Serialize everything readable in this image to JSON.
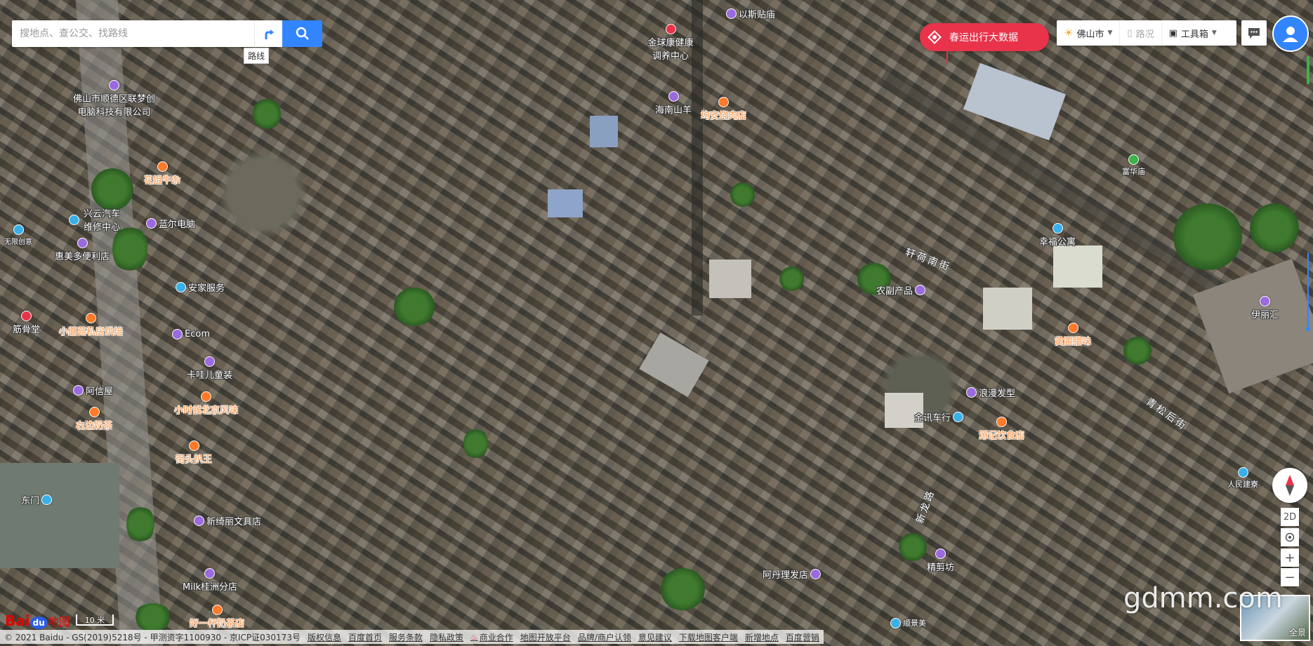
{
  "search": {
    "placeholder": "搜地点、查公交、找路线",
    "route_tooltip": "路线"
  },
  "banner": {
    "label": "春运出行大数据"
  },
  "toolbar": {
    "city": "佛山市",
    "traffic": "路况",
    "tools": "工具箱"
  },
  "controls": {
    "mode_2d": "2D",
    "zoom_in": "+",
    "zoom_out": "−",
    "panorama": "全景"
  },
  "scale": {
    "label": "10 米"
  },
  "logo": {
    "bai": "Bai",
    "du": "du",
    "map": "地图"
  },
  "watermark": "gdmm.com",
  "colors": {
    "accent": "#3385ff",
    "poi_shop": "#9c6adf",
    "poi_food": "#ff7a29",
    "poi_service": "#3ab0e8",
    "poi_health": "#e8334a",
    "poi_park": "#3db24a"
  },
  "pois": [
    {
      "name": "以斯贴庙",
      "cat": "shop"
    },
    {
      "name": "金球康健康调养中心",
      "cat": "health"
    },
    {
      "name": "佛山市顺德区联梦创电脑科技有限公司",
      "cat": "shop"
    },
    {
      "name": "海南山羊",
      "cat": "shop"
    },
    {
      "name": "均安烧肉店",
      "cat": "food"
    },
    {
      "name": "花姐牛杂",
      "cat": "food"
    },
    {
      "name": "兴云汽车维修中心",
      "cat": "service"
    },
    {
      "name": "蓝尔电脑",
      "cat": "shop"
    },
    {
      "name": "无限创意",
      "cat": "service"
    },
    {
      "name": "惠美多便利店",
      "cat": "shop"
    },
    {
      "name": "安家服务",
      "cat": "service"
    },
    {
      "name": "筋骨堂",
      "cat": "health"
    },
    {
      "name": "小蘑菇私房烘焙",
      "cat": "food"
    },
    {
      "name": "Ecom",
      "cat": "shop"
    },
    {
      "name": "卡哇儿童装",
      "cat": "shop"
    },
    {
      "name": "阿信屋",
      "cat": "shop"
    },
    {
      "name": "小时候北京风味",
      "cat": "food"
    },
    {
      "name": "右边奶茶",
      "cat": "food"
    },
    {
      "name": "街头扒王",
      "cat": "food"
    },
    {
      "name": "东门",
      "cat": "service"
    },
    {
      "name": "新绮丽文具店",
      "cat": "shop"
    },
    {
      "name": "Milk桂洲分店",
      "cat": "shop"
    },
    {
      "name": "好一杯奶茶店",
      "cat": "food"
    },
    {
      "name": "农副产品",
      "cat": "shop"
    },
    {
      "name": "幸福公寓",
      "cat": "service"
    },
    {
      "name": "黄圃腊味",
      "cat": "food"
    },
    {
      "name": "伊丽汇",
      "cat": "shop"
    },
    {
      "name": "浪漫发型",
      "cat": "shop"
    },
    {
      "name": "金讯车行",
      "cat": "service"
    },
    {
      "name": "源记饮食店",
      "cat": "food"
    },
    {
      "name": "人民建寮",
      "cat": "service"
    },
    {
      "name": "精剪坊",
      "cat": "shop"
    },
    {
      "name": "阿丹理发店",
      "cat": "shop"
    },
    {
      "name": "顺景美",
      "cat": "service"
    },
    {
      "name": "富华庙",
      "cat": "park"
    }
  ],
  "streets": [
    "轩荷南街",
    "青松后街",
    "新龙路"
  ],
  "footer": {
    "copyright": "© 2021 Baidu - GS(2019)5218号 - 甲测资字1100930 - 京ICP证030173号",
    "links": [
      "版权信息",
      "百度首页",
      "服务条款",
      "隐私政策",
      "商业合作",
      "地图开放平台",
      "品牌/商户认领",
      "意见建议",
      "下载地图客户端",
      "新增地点",
      "百度营销"
    ]
  }
}
